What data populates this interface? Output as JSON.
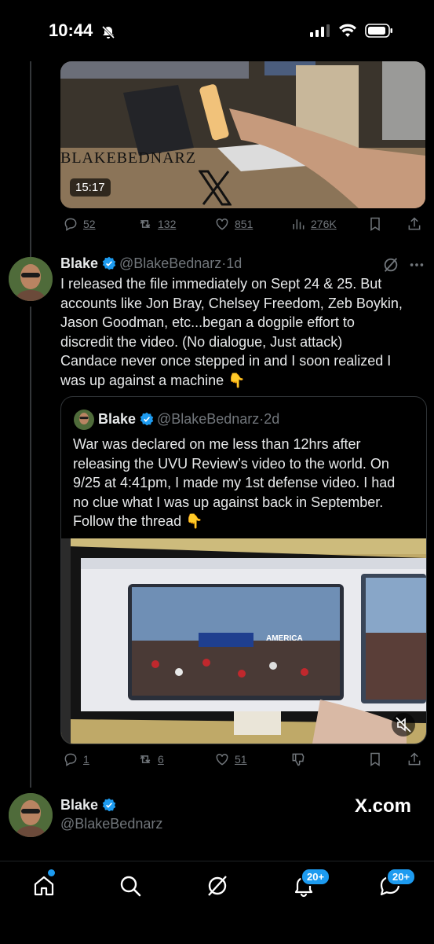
{
  "status": {
    "time": "10:44"
  },
  "video1": {
    "watermark": "BLAKEBEDNARZ",
    "duration": "15:17"
  },
  "actions1": {
    "replies": "52",
    "reposts": "132",
    "likes": "851",
    "views": "276K"
  },
  "tweet": {
    "name": "Blake",
    "handle": "@BlakeBednarz",
    "time": "1d",
    "lines": [
      "I released the file immediately on Sept 24 & 25. But",
      "accounts like Jon Bray, Chelsey Freedom, Zeb Boykin,",
      "Jason Goodman, etc...began a dogpile effort to",
      "discredit the video. (No dialogue, Just attack)",
      "Candace never once stepped in and I soon realized I",
      "was up against a machine 👇"
    ]
  },
  "quote": {
    "name": "Blake",
    "handle": "@BlakeBednarz",
    "time": "2d",
    "lines": [
      "War was declared on me less than 12hrs after",
      "releasing the UVU Review’s video to the world. On",
      "9/25 at 4:41pm, I made my 1st defense video. I had",
      "no clue what I was up against back in September.",
      "Follow the thread 👇"
    ],
    "screen_sign": "AMERICA"
  },
  "actions2": {
    "replies": "1",
    "reposts": "6",
    "likes": "51"
  },
  "footer": {
    "name": "Blake",
    "handle": "@BlakeBednarz",
    "brand": "X.com"
  },
  "nav": {
    "notifications_badge": "20+",
    "messages_badge": "20+"
  },
  "colors": {
    "accent": "#1d9bf0",
    "muted": "#71767b",
    "text": "#e7e9ea"
  }
}
